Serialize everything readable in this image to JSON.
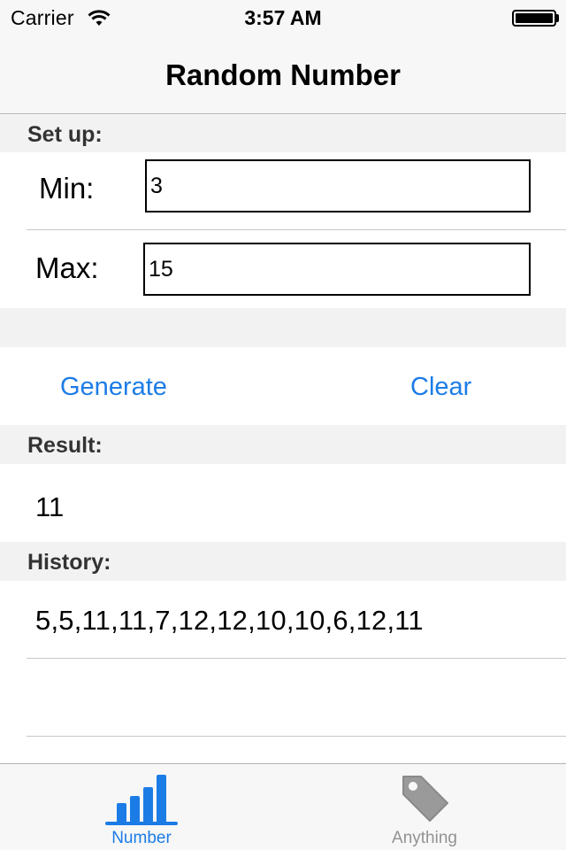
{
  "status_bar": {
    "carrier": "Carrier",
    "time": "3:57 AM",
    "wifi_icon": "wifi-icon",
    "battery_icon": "battery-icon"
  },
  "nav": {
    "title": "Random Number"
  },
  "setup": {
    "header": "Set up:",
    "min_label": "Min:",
    "min_value": "3",
    "max_label": "Max:",
    "max_value": "15"
  },
  "actions": {
    "generate_label": "Generate",
    "clear_label": "Clear"
  },
  "result": {
    "header": "Result:",
    "value": "11"
  },
  "history": {
    "header": "History:",
    "value": "5,5,11,11,7,12,12,10,10,6,12,11"
  },
  "tab_bar": {
    "tabs": [
      {
        "label": "Number",
        "icon": "bar-chart-icon",
        "selected": true
      },
      {
        "label": "Anything",
        "icon": "tag-icon",
        "selected": false
      }
    ],
    "active_color": "#1c7ce6",
    "inactive_color": "#929292"
  },
  "colors": {
    "accent": "#1c7ce6",
    "bar_background": "#f7f7f7",
    "section_background": "#f2f2f2"
  }
}
